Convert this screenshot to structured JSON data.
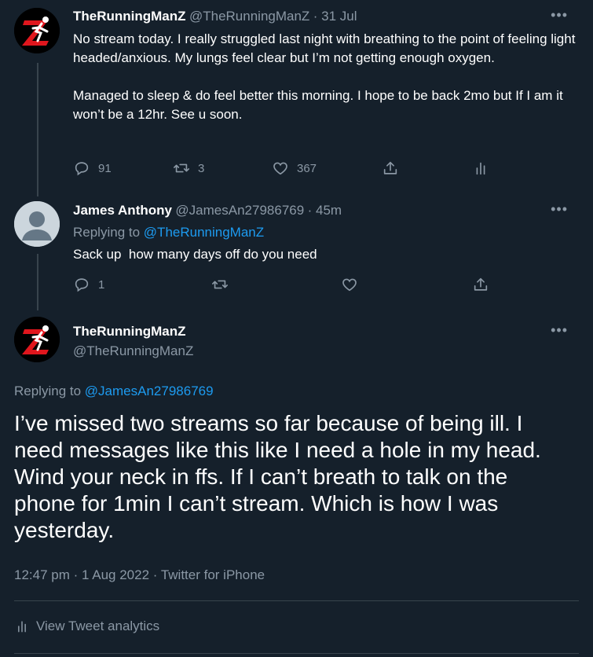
{
  "tweet1": {
    "name": "TheRunningManZ",
    "handle": "@TheRunningManZ",
    "time": "· 31 Jul",
    "text": "No stream today. I really struggled last night with breathing to the point of feeling light headed/anxious. My lungs feel clear but I’m not getting enough oxygen.\n\nManaged to sleep & do feel better this morning. I hope to be back 2mo but If I am it won’t be a 12hr. See u soon.",
    "replies": "91",
    "retweets": "3",
    "likes": "367"
  },
  "tweet2": {
    "name": "James Anthony",
    "handle": "@JamesAn27986769",
    "time": "· 45m",
    "replying_prefix": "Replying to",
    "replying_to": "@TheRunningManZ",
    "text": "Sack up  how many days off do you need",
    "replies": "1"
  },
  "tweet3": {
    "name": "TheRunningManZ",
    "handle": "@TheRunningManZ",
    "replying_prefix": "Replying to",
    "replying_to": "@JamesAn27986769",
    "text": "I’ve missed two streams so far because of being ill. I need messages like this like I need a hole in my head. Wind your neck in ffs. If I can’t breath to talk on the phone for 1min I can’t stream. Which is how I was yesterday.",
    "timestamp": "12:47 pm · 1 Aug 2022 · Twitter for iPhone",
    "analytics": "View Tweet analytics"
  },
  "icons": {
    "more": "more-horizontal-icon",
    "reply": "reply-icon",
    "retweet": "retweet-icon",
    "like": "heart-icon",
    "share": "share-icon",
    "analytics": "analytics-icon"
  },
  "colors": {
    "background": "#15202b",
    "muted": "#8b98a5",
    "link": "#1d9bf0",
    "border": "#38444d",
    "logo_red": "#e0161d"
  }
}
